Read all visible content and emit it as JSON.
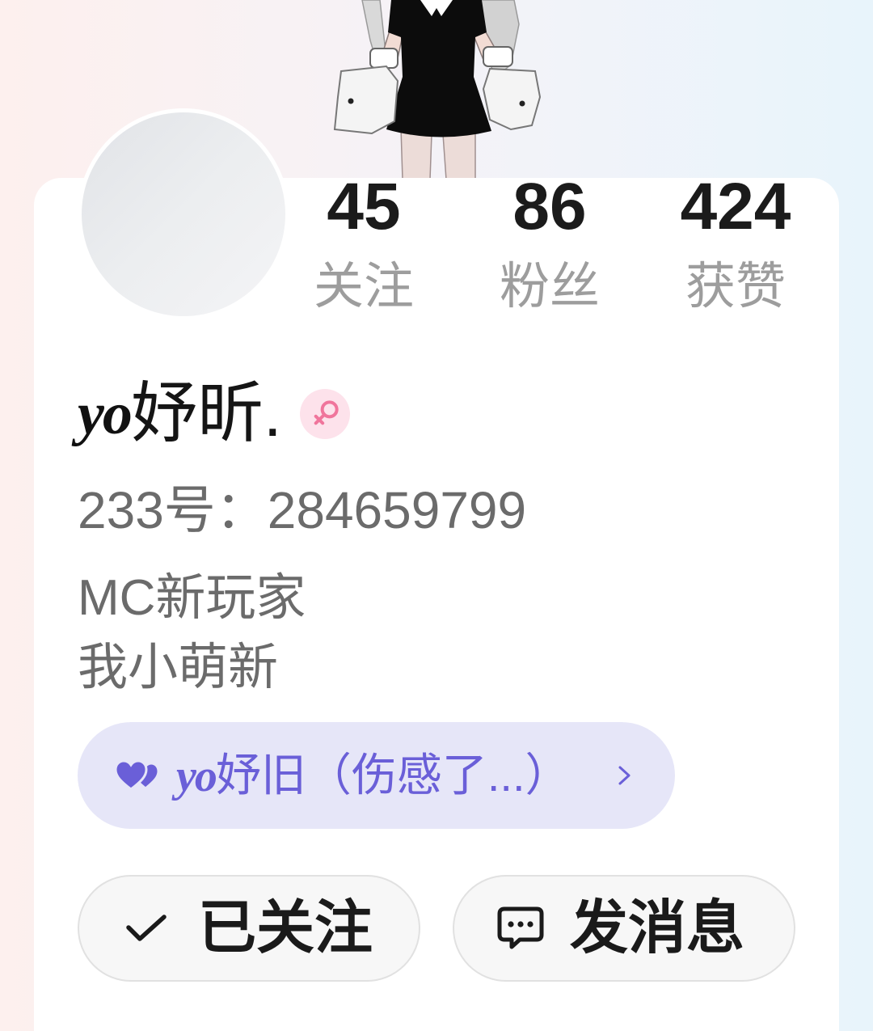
{
  "profile": {
    "stats": [
      {
        "value": "45",
        "label": "关注"
      },
      {
        "value": "86",
        "label": "粉丝"
      },
      {
        "value": "424",
        "label": "获赞"
      }
    ],
    "name_prefix": "yo",
    "name_main": "妤昕.",
    "gender_icon": "female-icon",
    "id_text": "233号：284659799",
    "bio": [
      "MC新玩家",
      "我小萌新"
    ],
    "group": {
      "icon": "hearts-icon",
      "name_prefix": "yo",
      "name_main": "妤旧（伤感了...）",
      "chevron_icon": "chevron-right-icon"
    },
    "actions": {
      "follow": {
        "icon": "check-icon",
        "label": "已关注"
      },
      "message": {
        "icon": "chat-bubble-icon",
        "label": "发消息"
      }
    }
  },
  "colors": {
    "accent": "#6a5fd8",
    "group_pill_bg": "#e6e6f8",
    "gender_pink": "#f0759c",
    "gender_badge_bg": "#fde2eb",
    "text_primary": "#1a1a1a",
    "text_secondary": "#6b6b6b",
    "text_muted": "#9d9d9d"
  }
}
